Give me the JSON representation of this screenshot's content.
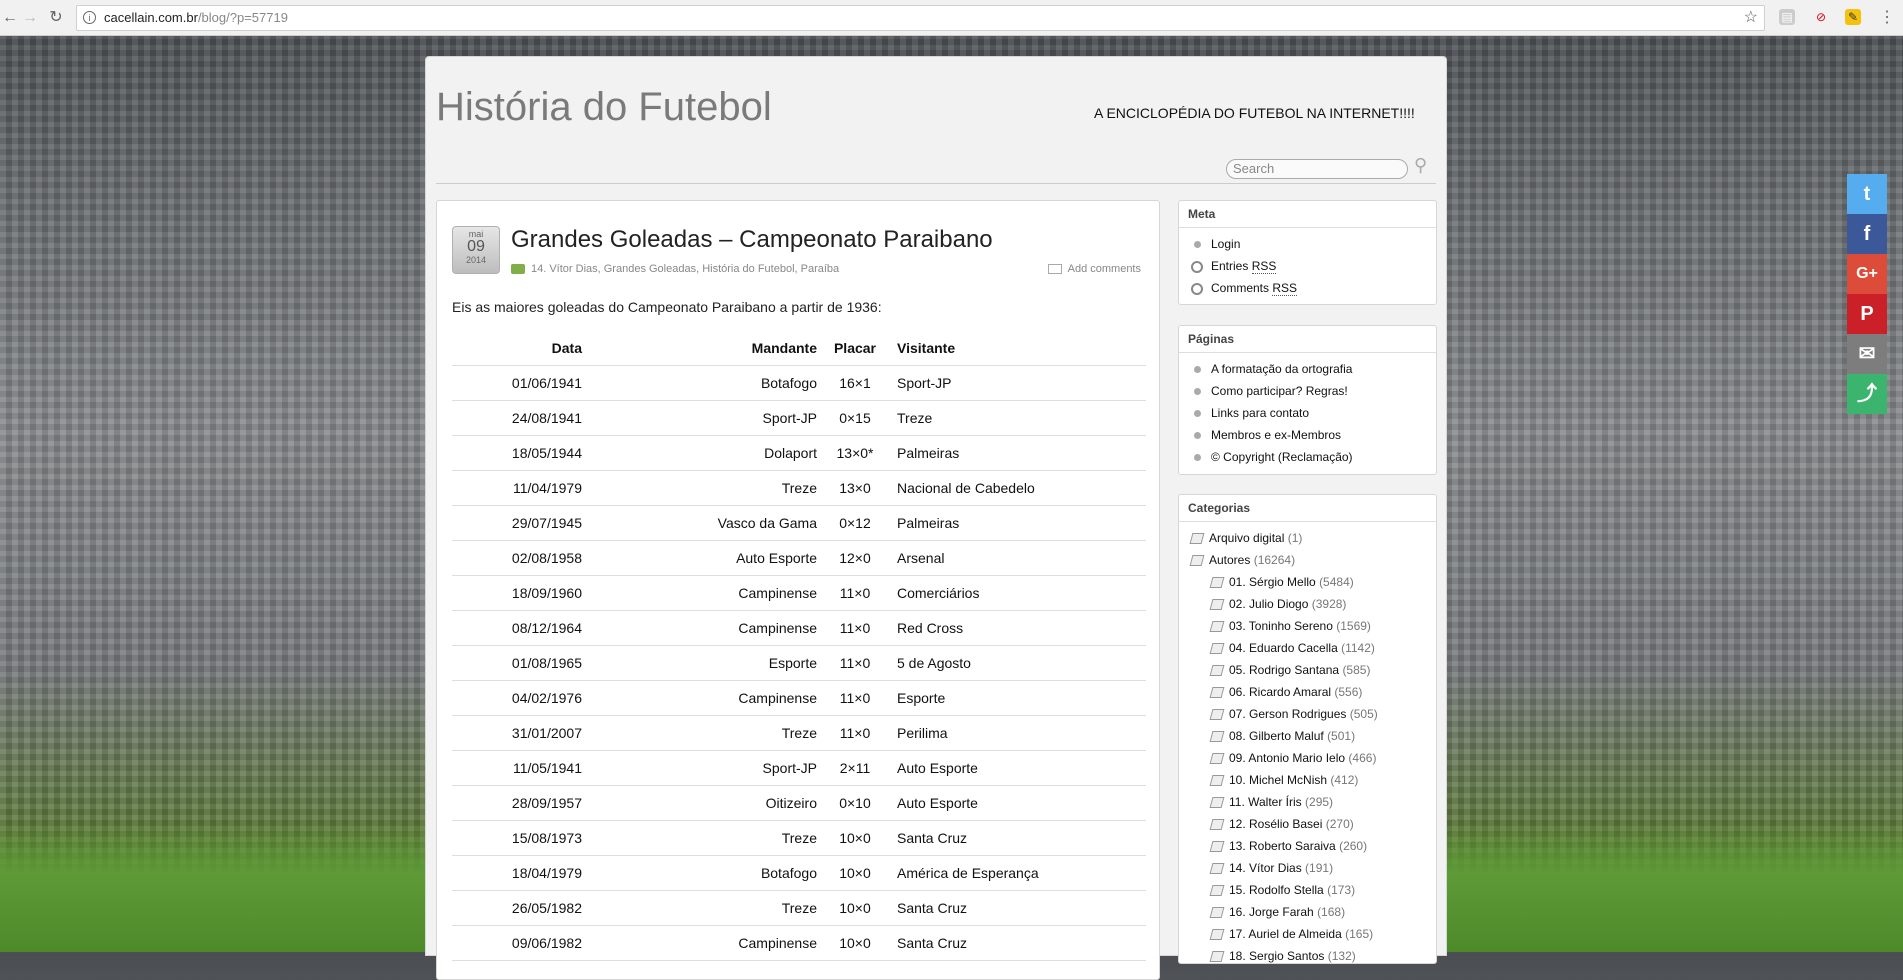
{
  "browser": {
    "url_host": "cacellain.com.br",
    "url_path": "/blog/?p=57719"
  },
  "site": {
    "title": "História do Futebol",
    "description": "A ENCICLOPÉDIA DO FUTEBOL NA INTERNET!!!!",
    "search_placeholder": "Search"
  },
  "post": {
    "date": {
      "month": "mai",
      "day": "09",
      "year": "2014"
    },
    "title": "Grandes Goleadas – Campeonato Paraibano",
    "categories": "14. Vítor Dias, Grandes Goleadas, História do Futebol, Paraíba",
    "comments_label": "Add comments",
    "intro": "Eis as maiores goleadas do Campeonato Paraibano a partir de 1936:",
    "table": {
      "headers": {
        "date": "Data",
        "home": "Mandante",
        "score": "Placar",
        "away": "Visitante"
      },
      "rows": [
        {
          "date": "01/06/1941",
          "home": "Botafogo",
          "score": "16×1",
          "away": "Sport-JP"
        },
        {
          "date": "24/08/1941",
          "home": "Sport-JP",
          "score": "0×15",
          "away": "Treze"
        },
        {
          "date": "18/05/1944",
          "home": "Dolaport",
          "score": "13×0*",
          "away": "Palmeiras"
        },
        {
          "date": "11/04/1979",
          "home": "Treze",
          "score": "13×0",
          "away": "Nacional de Cabedelo"
        },
        {
          "date": "29/07/1945",
          "home": "Vasco da Gama",
          "score": "0×12",
          "away": "Palmeiras"
        },
        {
          "date": "02/08/1958",
          "home": "Auto Esporte",
          "score": "12×0",
          "away": "Arsenal"
        },
        {
          "date": "18/09/1960",
          "home": "Campinense",
          "score": "11×0",
          "away": "Comerciários"
        },
        {
          "date": "08/12/1964",
          "home": "Campinense",
          "score": "11×0",
          "away": "Red Cross"
        },
        {
          "date": "01/08/1965",
          "home": "Esporte",
          "score": "11×0",
          "away": "5 de Agosto"
        },
        {
          "date": "04/02/1976",
          "home": "Campinense",
          "score": "11×0",
          "away": "Esporte"
        },
        {
          "date": "31/01/2007",
          "home": "Treze",
          "score": "11×0",
          "away": "Perilima"
        },
        {
          "date": "11/05/1941",
          "home": "Sport-JP",
          "score": "2×11",
          "away": "Auto Esporte"
        },
        {
          "date": "28/09/1957",
          "home": "Oitizeiro",
          "score": "0×10",
          "away": "Auto Esporte"
        },
        {
          "date": "15/08/1973",
          "home": "Treze",
          "score": "10×0",
          "away": "Santa Cruz"
        },
        {
          "date": "18/04/1979",
          "home": "Botafogo",
          "score": "10×0",
          "away": "América de Esperança"
        },
        {
          "date": "26/05/1982",
          "home": "Treze",
          "score": "10×0",
          "away": "Santa Cruz"
        },
        {
          "date": "09/06/1982",
          "home": "Campinense",
          "score": "10×0",
          "away": "Santa Cruz"
        }
      ]
    }
  },
  "sidebar": {
    "meta": {
      "title": "Meta",
      "login": "Login",
      "entries_prefix": "Entries ",
      "comments_prefix": "Comments ",
      "rss": "RSS"
    },
    "pages": {
      "title": "Páginas",
      "items": [
        "A formatação da ortografia",
        "Como participar? Regras!",
        "Links para contato",
        "Membros e ex-Membros",
        "© Copyright (Reclamação)"
      ]
    },
    "categories": {
      "title": "Categorias",
      "items": [
        {
          "label": "Arquivo digital",
          "count": "(1)"
        },
        {
          "label": "Autores",
          "count": "(16264)"
        }
      ],
      "subitems": [
        {
          "label": "01. Sérgio Mello",
          "count": "(5484)"
        },
        {
          "label": "02. Julio Diogo",
          "count": "(3928)"
        },
        {
          "label": "03. Toninho Sereno",
          "count": "(1569)"
        },
        {
          "label": "04. Eduardo Cacella",
          "count": "(1142)"
        },
        {
          "label": "05. Rodrigo Santana",
          "count": "(585)"
        },
        {
          "label": "06. Ricardo Amaral",
          "count": "(556)"
        },
        {
          "label": "07. Gerson Rodrigues",
          "count": "(505)"
        },
        {
          "label": "08. Gilberto Maluf",
          "count": "(501)"
        },
        {
          "label": "09. Antonio Mario Ielo",
          "count": "(466)"
        },
        {
          "label": "10. Michel McNish",
          "count": "(412)"
        },
        {
          "label": "11. Walter Íris",
          "count": "(295)"
        },
        {
          "label": "12. Rosélio Basei",
          "count": "(270)"
        },
        {
          "label": "13. Roberto Saraiva",
          "count": "(260)"
        },
        {
          "label": "14. Vítor Dias",
          "count": "(191)"
        },
        {
          "label": "15. Rodolfo Stella",
          "count": "(173)"
        },
        {
          "label": "16. Jorge Farah",
          "count": "(168)"
        },
        {
          "label": "17. Auriel de Almeida",
          "count": "(165)"
        },
        {
          "label": "18. Sergio Santos",
          "count": "(132)"
        }
      ]
    }
  },
  "share": {
    "twitter_color": "#55acee",
    "facebook_color": "#3b5998",
    "google_color": "#dd4b39",
    "pinterest_color": "#cb2027",
    "email_color": "#7d7d7d",
    "more_color": "#3bb46e"
  }
}
